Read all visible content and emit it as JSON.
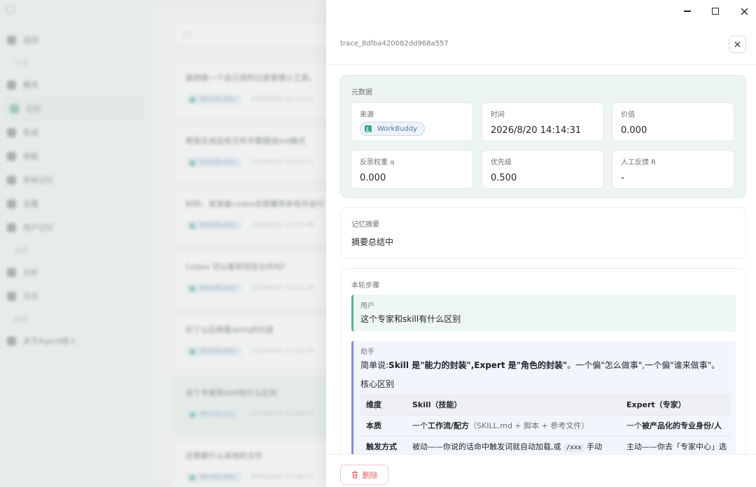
{
  "background": {
    "nav": [
      {
        "label": "返回"
      },
      {
        "label": "工作",
        "section": true
      },
      {
        "label": "概览"
      },
      {
        "label": "记忆",
        "active": true
      },
      {
        "label": "轨迹"
      },
      {
        "label": "技能"
      },
      {
        "label": "系统记忆"
      },
      {
        "label": "设置"
      },
      {
        "label": "用户记忆"
      },
      {
        "label": "训练",
        "section": true
      },
      {
        "label": "分析"
      },
      {
        "label": "日志"
      },
      {
        "label": "其他",
        "section": true
      },
      {
        "label": "关于Agent接入"
      }
    ],
    "cards": [
      {
        "title": "我想做一个自己用的记录管理小工具。",
        "chip": "WorkBuddy",
        "date": "2026/8/20 14:14:31"
      },
      {
        "title": "帮我生成这些文件并整理成md格式",
        "chip": "WorkBuddy",
        "date": "2026/8/20 14:10:11"
      },
      {
        "title": "好的，我准备codex去部署到本地并运行",
        "chip": "WorkBuddy",
        "date": "2026/8/20 14:05:48"
      },
      {
        "title": "Codex 可以看到项目文件吗？",
        "chip": "WorkBuddy",
        "date": "2026/8/20 14:01:36"
      },
      {
        "title": "好了以后再看skills的内容",
        "chip": "WorkBuddy",
        "date": "2026/8/20 13:52:19"
      },
      {
        "title": "这个专家和skill有什么区别",
        "chip": "WorkBuddy",
        "date": "2026/8/20 13:48:02",
        "selected": true
      },
      {
        "title": "还需要什么其他的文件",
        "chip": "WorkBuddy",
        "date": "2026/8/20 13:40:27"
      }
    ]
  },
  "drawer": {
    "trace_id": "trace_8dfba420082dd968a557",
    "metadata": {
      "label": "元数据",
      "source": {
        "key": "来源",
        "value": "WorkBuddy"
      },
      "time": {
        "key": "时间",
        "value": "2026/8/20 14:14:31"
      },
      "value": {
        "key": "价值",
        "value": "0.000"
      },
      "reflection_weight": {
        "key": "反思权重 α",
        "value": "0.000"
      },
      "priority": {
        "key": "优先级",
        "value": "0.500"
      },
      "human_feedback": {
        "key": "人工反馈 R",
        "value": "-"
      }
    },
    "summary": {
      "label": "记忆摘要",
      "text": "摘要总结中"
    },
    "steps": {
      "label": "本轮步骤",
      "user": {
        "role": "用户",
        "text": "这个专家和skill有什么区别"
      },
      "assistant": {
        "role": "助手",
        "intro": {
          "p1": "简单说:",
          "b1": "Skill 是\"能力的封装\",Expert 是\"角色的封装\"",
          "p2": "。一个偏\"怎么做事\",一个偏\"谁来做事\"。"
        },
        "section_title": "核心区别",
        "table": {
          "headers": [
            "维度",
            "Skill（技能）",
            "Expert（专家）"
          ],
          "row1": {
            "dim": "本质",
            "skill_a": "一个",
            "skill_b": "工作流/配方",
            "skill_c": "（SKILL.md + 脚本 + 参考文件）",
            "expert_a": "一个",
            "expert_b": "被产品化的专业身份/人"
          },
          "row2": {
            "dim": "触发方式",
            "skill_a": "被动——你说的话命中触发词就自动加载,或 ",
            "skill_code": "/xxx",
            "skill_c": " 手动",
            "expert": "主动——你去「专家中心」选"
          }
        }
      }
    },
    "footer": {
      "delete_label": "删除"
    }
  }
}
